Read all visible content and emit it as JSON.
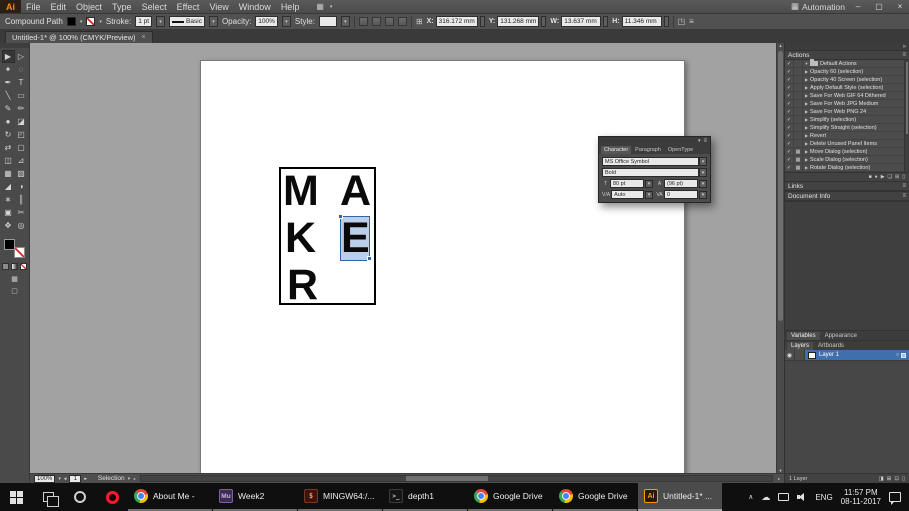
{
  "menubar": {
    "app_label": "Ai",
    "menus": [
      "File",
      "Edit",
      "Object",
      "Type",
      "Select",
      "Effect",
      "View",
      "Window",
      "Help"
    ],
    "workspace": "Automation",
    "window_buttons": {
      "minimize": "–",
      "restore": "▢",
      "close": "×"
    }
  },
  "controlbar": {
    "selection_type": "Compound Path",
    "stroke_label": "Stroke:",
    "stroke_value": "1 pt",
    "brush_value": "Basic",
    "opacity_label": "Opacity:",
    "opacity_value": "100%",
    "style_label": "Style:",
    "fields": [
      {
        "label": "X:",
        "value": "316.172 mm"
      },
      {
        "label": "Y:",
        "value": "131.268 mm"
      },
      {
        "label": "W:",
        "value": "13.637 mm"
      },
      {
        "label": "H:",
        "value": "11.346 mm"
      }
    ]
  },
  "doc_tab": {
    "title": "Untitled-1* @ 100% (CMYK/Preview)"
  },
  "tools": [
    {
      "name": "selection-tool",
      "glyph": "▶",
      "selected": true
    },
    {
      "name": "direct-selection-tool",
      "glyph": "▷"
    },
    {
      "name": "magic-wand-tool",
      "glyph": "✦"
    },
    {
      "name": "lasso-tool",
      "glyph": "◌"
    },
    {
      "name": "pen-tool",
      "glyph": "✒"
    },
    {
      "name": "type-tool",
      "glyph": "T"
    },
    {
      "name": "line-segment-tool",
      "glyph": "╲"
    },
    {
      "name": "rectangle-tool",
      "glyph": "▭"
    },
    {
      "name": "paintbrush-tool",
      "glyph": "✎"
    },
    {
      "name": "pencil-tool",
      "glyph": "✏"
    },
    {
      "name": "blob-brush-tool",
      "glyph": "●"
    },
    {
      "name": "eraser-tool",
      "glyph": "◪"
    },
    {
      "name": "rotate-tool",
      "glyph": "↻"
    },
    {
      "name": "scale-tool",
      "glyph": "◰"
    },
    {
      "name": "width-tool",
      "glyph": "⇄"
    },
    {
      "name": "free-transform-tool",
      "glyph": "▢"
    },
    {
      "name": "shape-builder-tool",
      "glyph": "◫"
    },
    {
      "name": "perspective-grid-tool",
      "glyph": "⊿"
    },
    {
      "name": "mesh-tool",
      "glyph": "▦"
    },
    {
      "name": "gradient-tool",
      "glyph": "▧"
    },
    {
      "name": "eyedropper-tool",
      "glyph": "◢"
    },
    {
      "name": "blend-tool",
      "glyph": "◑"
    },
    {
      "name": "symbol-sprayer-tool",
      "glyph": "∗"
    },
    {
      "name": "column-graph-tool",
      "glyph": "║"
    },
    {
      "name": "artboard-tool",
      "glyph": "▣"
    },
    {
      "name": "slice-tool",
      "glyph": "✂"
    },
    {
      "name": "hand-tool",
      "glyph": "✥"
    },
    {
      "name": "zoom-tool",
      "glyph": "◎"
    }
  ],
  "artboard": {
    "letters": [
      {
        "char": "M"
      },
      {
        "char": "A"
      },
      {
        "char": "K"
      },
      {
        "char": "E",
        "selected": true
      },
      {
        "char": "R"
      }
    ]
  },
  "character_panel": {
    "tabs": [
      {
        "label": "Character",
        "active": true
      },
      {
        "label": "Paragraph"
      },
      {
        "label": "OpenType"
      }
    ],
    "font_family": "MS Office Symbol",
    "font_style": "Bold",
    "font_size": "80 pt",
    "leading": "(96 pt)",
    "kerning": "Auto",
    "tracking": "0"
  },
  "actions_panel": {
    "title": "Actions",
    "rows": [
      {
        "label": "Default Actions",
        "set": true
      },
      {
        "label": "Opacity 60 (selection)"
      },
      {
        "label": "Opacity 40 Screen (selection)"
      },
      {
        "label": "Apply Default Style (selection)"
      },
      {
        "label": "Save For Web GIF 64 Dithered"
      },
      {
        "label": "Save For Web JPG Medium"
      },
      {
        "label": "Save For Web PNG 24"
      },
      {
        "label": "Simplify (selection)"
      },
      {
        "label": "Simplify Straight (selection)"
      },
      {
        "label": "Revert"
      },
      {
        "label": "Delete Unused Panel Items"
      },
      {
        "label": "Move Dialog (selection)",
        "dialog": true
      },
      {
        "label": "Scale Dialog (selection)",
        "dialog": true
      },
      {
        "label": "Rotate Dialog (selection)",
        "dialog": true
      }
    ]
  },
  "side_panels": {
    "links_title": "Links",
    "docinfo_title": "Document Info",
    "panel_tabs1": [
      {
        "label": "Variables",
        "active": true
      },
      {
        "label": "Appearance"
      }
    ],
    "panel_tabs2": [
      {
        "label": "Layers",
        "active": true
      },
      {
        "label": "Artboards"
      }
    ],
    "layer_name": "Layer 1",
    "layers_footer": "1 Layer"
  },
  "statusbar": {
    "zoom": "100%",
    "artboard_number": "1",
    "status": "Selection"
  },
  "taskbar": {
    "apps": [
      {
        "icon": "chrome",
        "icon_name": "chrome-icon",
        "label": "About Me -"
      },
      {
        "icon": "muse",
        "icon_name": "muse-icon",
        "icon_text": "Mu",
        "label": "Week2"
      },
      {
        "icon": "gitbash",
        "icon_name": "git-bash-icon",
        "icon_text": "$",
        "label": "MINGW64:/..."
      },
      {
        "icon": "cmd",
        "icon_name": "terminal-icon",
        "icon_text": ">_",
        "label": "depth1"
      },
      {
        "icon": "chrome",
        "icon_name": "chrome-icon",
        "label": "Google Drive"
      },
      {
        "icon": "chrome",
        "icon_name": "chrome-icon",
        "label": "Google Drive"
      },
      {
        "icon": "illustrator",
        "icon_name": "illustrator-icon",
        "icon_text": "Ai",
        "label": "Untitled-1* ...",
        "active": true
      }
    ],
    "tray": {
      "language": "ENG",
      "time": "11:57 PM",
      "date": "08-11-2017"
    }
  }
}
